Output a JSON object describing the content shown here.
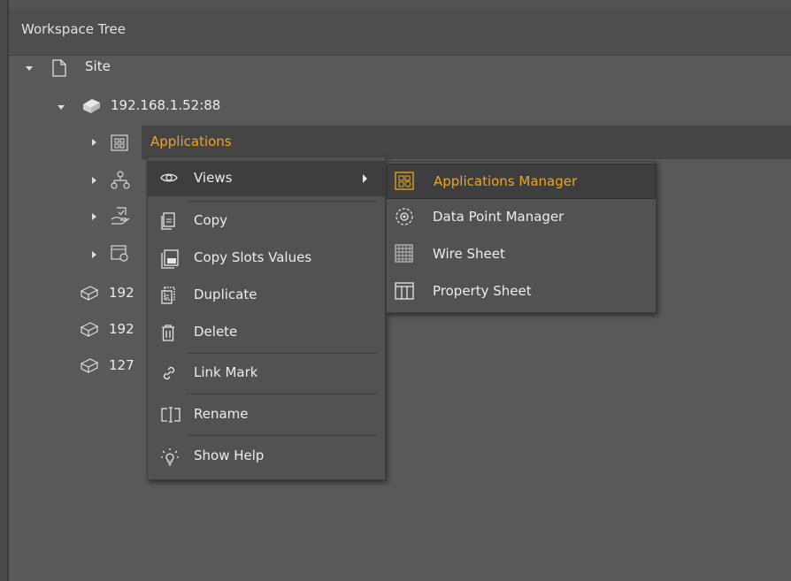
{
  "panel": {
    "title": "Workspace Tree"
  },
  "tree": {
    "site": {
      "label": "Site",
      "icon": "page-icon"
    },
    "device": {
      "label": "192.168.1.52:88",
      "icon": "device-icon"
    },
    "children": [
      {
        "label": "Applications",
        "icon": "applications-icon",
        "selected": true
      },
      {
        "label": "",
        "icon": "network-icon"
      },
      {
        "label": "",
        "icon": "services-icon"
      },
      {
        "label": "",
        "icon": "panel-icon"
      }
    ],
    "other_devices": [
      "192",
      "192",
      "127"
    ]
  },
  "context_menu": {
    "items": [
      {
        "label": "Views",
        "icon": "eye-icon",
        "has_submenu": true
      },
      {
        "label": "Copy",
        "icon": "copy-icon"
      },
      {
        "label": "Copy Slots Values",
        "icon": "copy-slots-icon"
      },
      {
        "label": "Duplicate",
        "icon": "duplicate-icon"
      },
      {
        "label": "Delete",
        "icon": "trash-icon"
      },
      {
        "label": "Link Mark",
        "icon": "link-icon"
      },
      {
        "label": "Rename",
        "icon": "rename-icon"
      },
      {
        "label": "Show Help",
        "icon": "lightbulb-icon"
      }
    ]
  },
  "views_submenu": {
    "items": [
      {
        "label": "Applications Manager",
        "icon": "applications-manager-icon",
        "active": true
      },
      {
        "label": "Data Point Manager",
        "icon": "data-point-icon"
      },
      {
        "label": "Wire Sheet",
        "icon": "wire-sheet-icon"
      },
      {
        "label": "Property Sheet",
        "icon": "property-sheet-icon"
      }
    ]
  },
  "colors": {
    "accent": "#f0a51c",
    "background": "#595959",
    "menu": "#525252"
  }
}
